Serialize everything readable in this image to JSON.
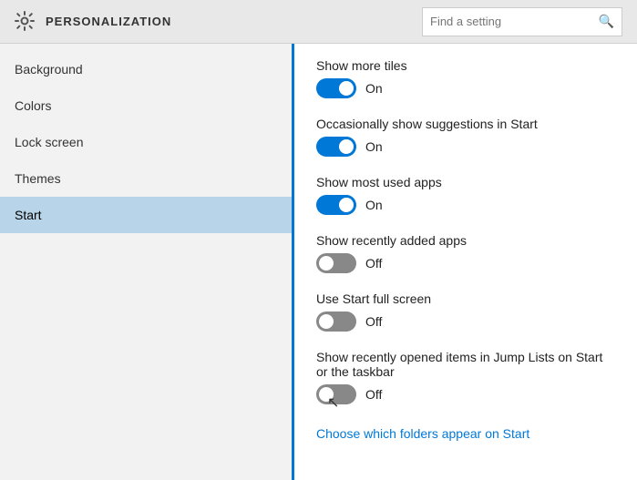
{
  "header": {
    "title": "PERSONALIZATION",
    "search_placeholder": "Find a setting",
    "gear_icon": "⚙"
  },
  "sidebar": {
    "items": [
      {
        "id": "background",
        "label": "Background"
      },
      {
        "id": "colors",
        "label": "Colors"
      },
      {
        "id": "lock-screen",
        "label": "Lock screen"
      },
      {
        "id": "themes",
        "label": "Themes"
      },
      {
        "id": "start",
        "label": "Start"
      }
    ]
  },
  "content": {
    "settings": [
      {
        "id": "show-more-tiles",
        "label": "Show more tiles",
        "state": "on",
        "state_label": "On"
      },
      {
        "id": "show-suggestions",
        "label": "Occasionally show suggestions in Start",
        "state": "on",
        "state_label": "On"
      },
      {
        "id": "show-most-used",
        "label": "Show most used apps",
        "state": "on",
        "state_label": "On"
      },
      {
        "id": "show-recently-added",
        "label": "Show recently added apps",
        "state": "off",
        "state_label": "Off"
      },
      {
        "id": "use-start-full-screen",
        "label": "Use Start full screen",
        "state": "off",
        "state_label": "Off"
      },
      {
        "id": "show-jump-lists",
        "label": "Show recently opened items in Jump Lists on Start or the taskbar",
        "state": "off",
        "state_label": "Off"
      }
    ],
    "link": {
      "label": "Choose which folders appear on Start"
    }
  }
}
